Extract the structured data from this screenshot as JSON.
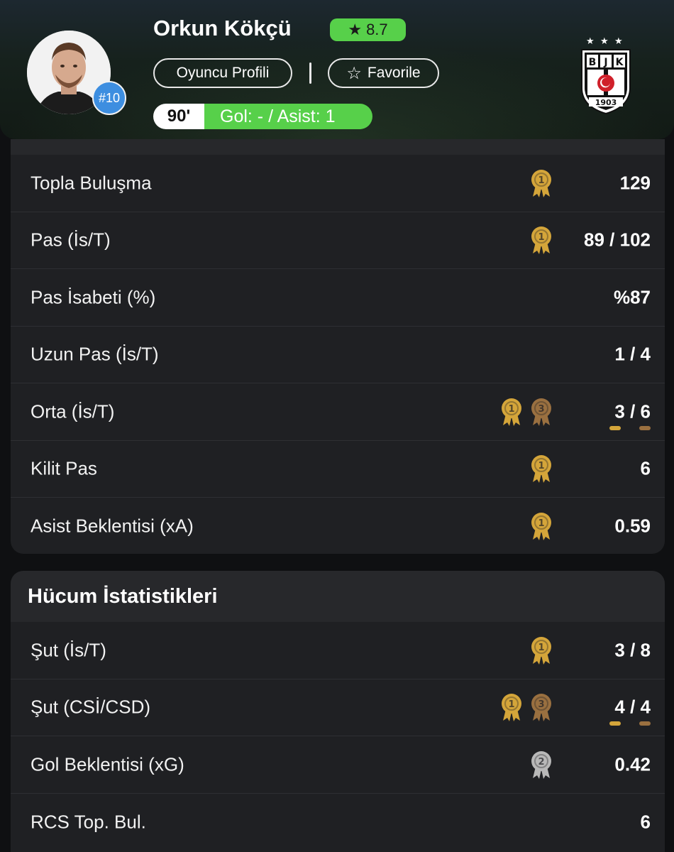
{
  "header": {
    "player_name": "Orkun Kökçü",
    "rating": "8.7",
    "rating_icon": "star-icon",
    "jersey_number": "#10",
    "profile_button": "Oyuncu Profili",
    "favorite_button": "Favorile",
    "favorite_icon": "star-outline-icon",
    "minutes": "90'",
    "goal_assist": "Gol: - / Asist: 1",
    "club_logo_letters": [
      "B",
      "J",
      "K"
    ],
    "club_logo_year": "1903",
    "colors": {
      "rating_green": "#57d04a",
      "jersey_blue": "#3d8ee0"
    }
  },
  "passing_card": {
    "rows": [
      {
        "label": "Topla Buluşma",
        "value": "129",
        "medals": [
          "1"
        ]
      },
      {
        "label": "Pas (İs/T)",
        "value": "89 / 102",
        "medals": [
          "1"
        ]
      },
      {
        "label": "Pas İsabeti (%)",
        "value": "%87",
        "medals": []
      },
      {
        "label": "Uzun Pas (İs/T)",
        "value": "1 / 4",
        "medals": []
      },
      {
        "label": "Orta (İs/T)",
        "value": "3 / 6",
        "medals": [
          "1",
          "3"
        ]
      },
      {
        "label": "Kilit Pas",
        "value": "6",
        "medals": [
          "1"
        ]
      },
      {
        "label": "Asist Beklentisi (xA)",
        "value": "0.59",
        "medals": [
          "1"
        ]
      }
    ]
  },
  "attack_card": {
    "title": "Hücum İstatistikleri",
    "rows": [
      {
        "label": "Şut (İs/T)",
        "value": "3 / 8",
        "medals": [
          "1"
        ]
      },
      {
        "label": "Şut (CSİ/CSD)",
        "value": "4 / 4",
        "medals": [
          "1",
          "3"
        ]
      },
      {
        "label": "Gol Beklentisi (xG)",
        "value": "0.42",
        "medals": [
          "2"
        ]
      },
      {
        "label": "RCS Top. Bul.",
        "value": "6",
        "medals": []
      }
    ]
  },
  "medal_colors": {
    "1": "#d4a53a",
    "2": "#b8b8b8",
    "3": "#9a7040"
  }
}
